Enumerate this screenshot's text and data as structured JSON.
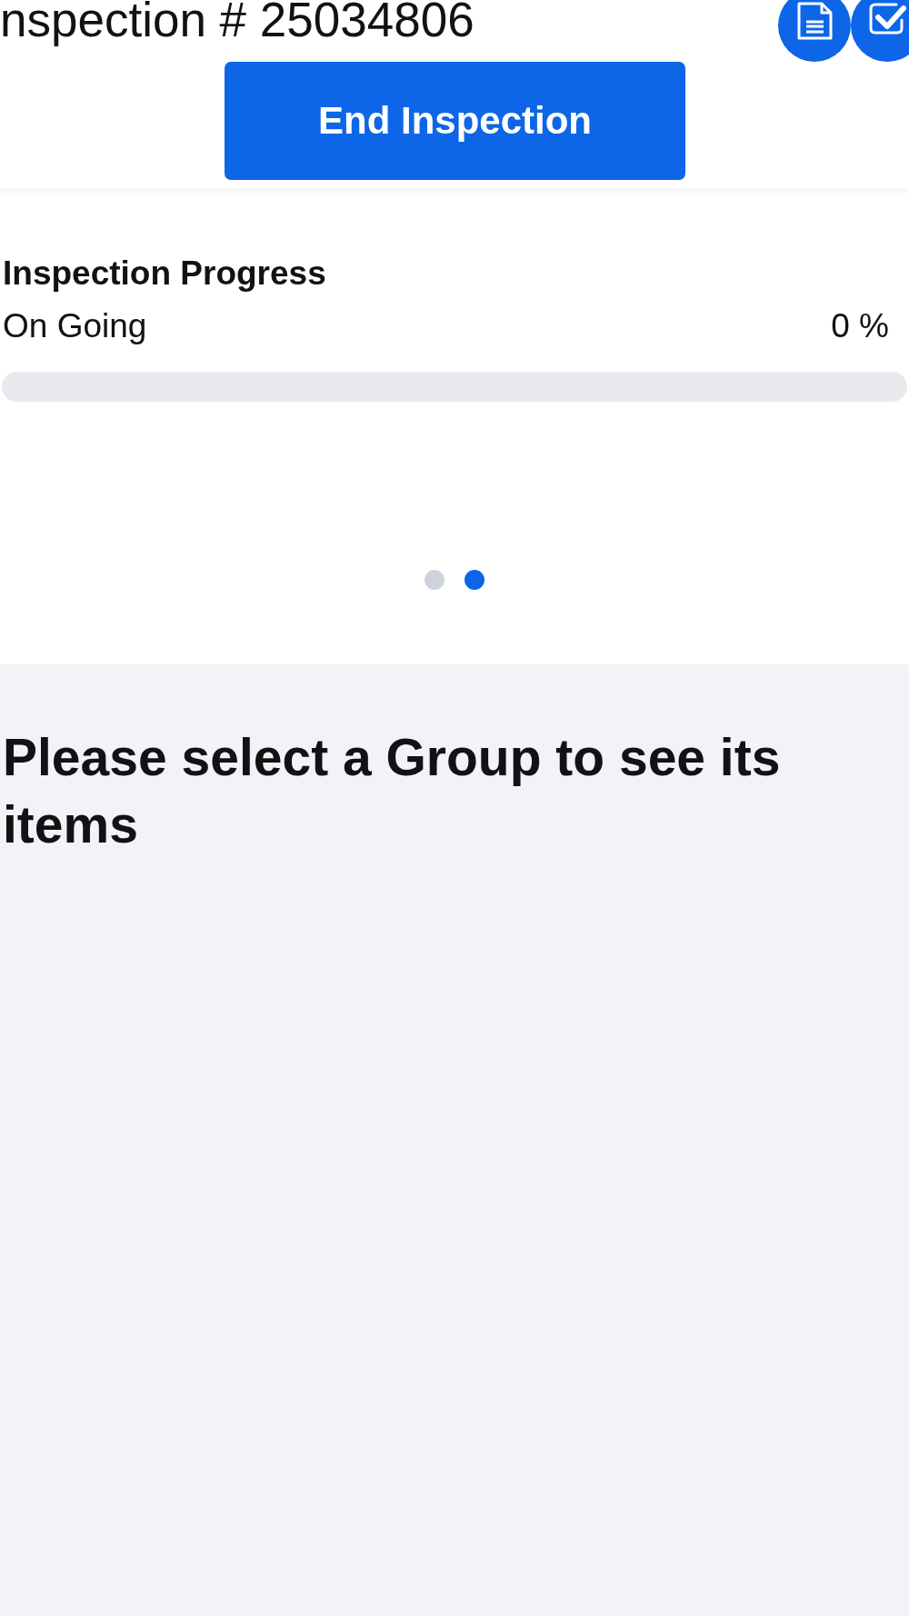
{
  "header": {
    "title": "nspection # 25034806",
    "icon_buttons": [
      {
        "kind": "document"
      },
      {
        "kind": "checklist"
      }
    ],
    "end_button": "End Inspection"
  },
  "progress": {
    "title": "Inspection Progress",
    "status": "On Going",
    "reading": "0 %",
    "level": 0
  },
  "pager": [
    {
      "selected": false
    },
    {
      "selected": true
    }
  ],
  "group_panel": {
    "message": "Please select a Group to see its items"
  }
}
